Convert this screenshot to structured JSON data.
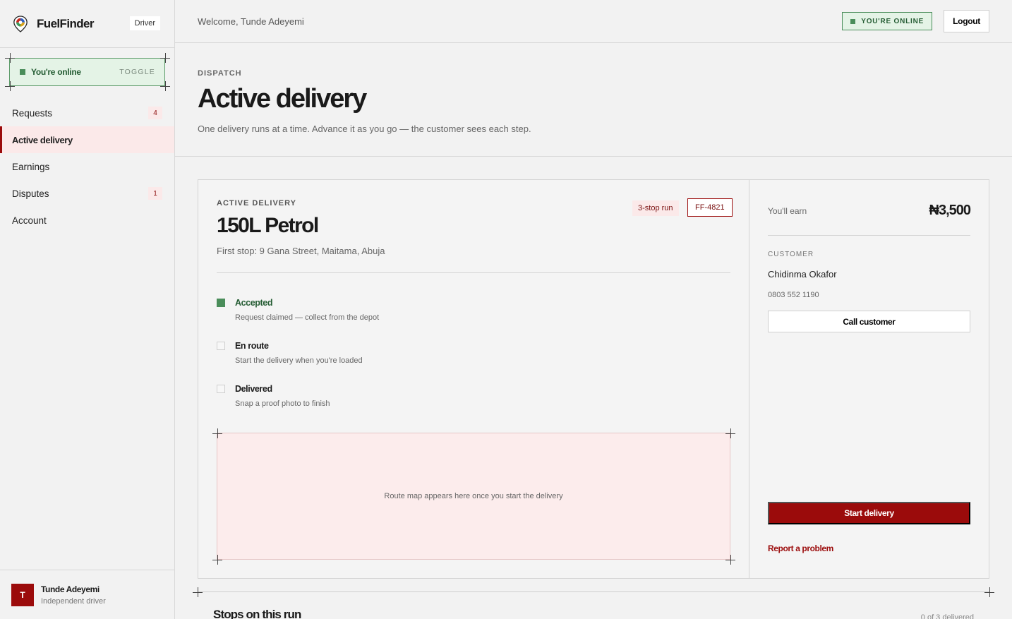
{
  "brand": {
    "name": "FuelFinder",
    "role": "Driver"
  },
  "sidebar": {
    "online_label": "You're online",
    "online_toggle": "TOGGLE",
    "items": [
      {
        "label": "Requests",
        "badge": "4"
      },
      {
        "label": "Active delivery",
        "badge": ""
      },
      {
        "label": "Earnings",
        "badge": ""
      },
      {
        "label": "Disputes",
        "badge": "1"
      },
      {
        "label": "Account",
        "badge": ""
      }
    ],
    "user": {
      "initial": "T",
      "name": "Tunde Adeyemi",
      "subtitle": "Independent driver"
    }
  },
  "topbar": {
    "welcome": "Welcome, Tunde Adeyemi",
    "status": "YOU'RE ONLINE",
    "logout": "Logout"
  },
  "header": {
    "eyebrow": "DISPATCH",
    "title": "Active delivery",
    "subtitle": "One delivery runs at a time. Advance it as you go — the customer sees each step."
  },
  "delivery": {
    "eyebrow": "ACTIVE DELIVERY",
    "title": "150L Petrol",
    "address": "First stop: 9 Gana Street, Maitama, Abuja",
    "stops_tag": "3-stop run",
    "id_tag": "FF-4821",
    "steps": [
      {
        "label": "Accepted",
        "hint": "Request claimed — collect from the depot",
        "done": true
      },
      {
        "label": "En route",
        "hint": "Start the delivery when you're loaded",
        "done": false
      },
      {
        "label": "Delivered",
        "hint": "Snap a proof photo to finish",
        "done": false
      }
    ],
    "map_placeholder": "Route map appears here once you start the delivery"
  },
  "summary": {
    "earn_label": "You'll earn",
    "earn_value": "₦3,500",
    "customer_eyebrow": "CUSTOMER",
    "customer_name": "Chidinma Okafor",
    "customer_phone": "0803 552 1190",
    "call_button": "Call customer",
    "start_button": "Start delivery",
    "report_link": "Report a problem"
  },
  "stops_section": {
    "title": "Stops on this run",
    "count": "0 of 3 delivered"
  },
  "colors": {
    "accent": "#9b0b0b",
    "online": "#4a8d5a",
    "online_bg": "#e4f3e6",
    "accent_bg": "#fbe9e9"
  }
}
